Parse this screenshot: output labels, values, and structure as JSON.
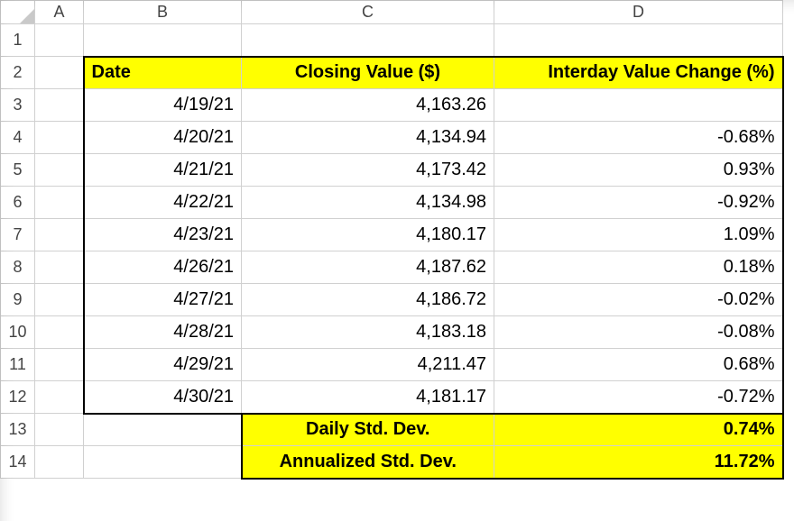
{
  "columns": [
    "A",
    "B",
    "C",
    "D"
  ],
  "row_labels": [
    "1",
    "2",
    "3",
    "4",
    "5",
    "6",
    "7",
    "8",
    "9",
    "10",
    "11",
    "12",
    "13",
    "14"
  ],
  "headers": {
    "date": "Date",
    "closing": "Closing Value ($)",
    "change": "Interday Value Change (%)"
  },
  "rows": [
    {
      "date": "4/19/21",
      "closing": "4,163.26",
      "change": ""
    },
    {
      "date": "4/20/21",
      "closing": "4,134.94",
      "change": "-0.68%"
    },
    {
      "date": "4/21/21",
      "closing": "4,173.42",
      "change": "0.93%"
    },
    {
      "date": "4/22/21",
      "closing": "4,134.98",
      "change": "-0.92%"
    },
    {
      "date": "4/23/21",
      "closing": "4,180.17",
      "change": "1.09%"
    },
    {
      "date": "4/26/21",
      "closing": "4,187.62",
      "change": "0.18%"
    },
    {
      "date": "4/27/21",
      "closing": "4,186.72",
      "change": "-0.02%"
    },
    {
      "date": "4/28/21",
      "closing": "4,183.18",
      "change": "-0.08%"
    },
    {
      "date": "4/29/21",
      "closing": "4,211.47",
      "change": "0.68%"
    },
    {
      "date": "4/30/21",
      "closing": "4,181.17",
      "change": "-0.72%"
    }
  ],
  "summary": {
    "daily_label": "Daily Std. Dev.",
    "daily_value": "0.74%",
    "annual_label": "Annualized Std. Dev.",
    "annual_value": "11.72%"
  },
  "chart_data": {
    "type": "table",
    "title": "",
    "columns": [
      "Date",
      "Closing Value ($)",
      "Interday Value Change (%)"
    ],
    "data": [
      [
        "4/19/21",
        4163.26,
        null
      ],
      [
        "4/20/21",
        4134.94,
        -0.68
      ],
      [
        "4/21/21",
        4173.42,
        0.93
      ],
      [
        "4/22/21",
        4134.98,
        -0.92
      ],
      [
        "4/23/21",
        4180.17,
        1.09
      ],
      [
        "4/26/21",
        4187.62,
        0.18
      ],
      [
        "4/27/21",
        4186.72,
        -0.02
      ],
      [
        "4/28/21",
        4183.18,
        -0.08
      ],
      [
        "4/29/21",
        4211.47,
        0.68
      ],
      [
        "4/30/21",
        4181.17,
        -0.72
      ]
    ],
    "summary": {
      "Daily Std. Dev.": 0.74,
      "Annualized Std. Dev.": 11.72
    }
  }
}
